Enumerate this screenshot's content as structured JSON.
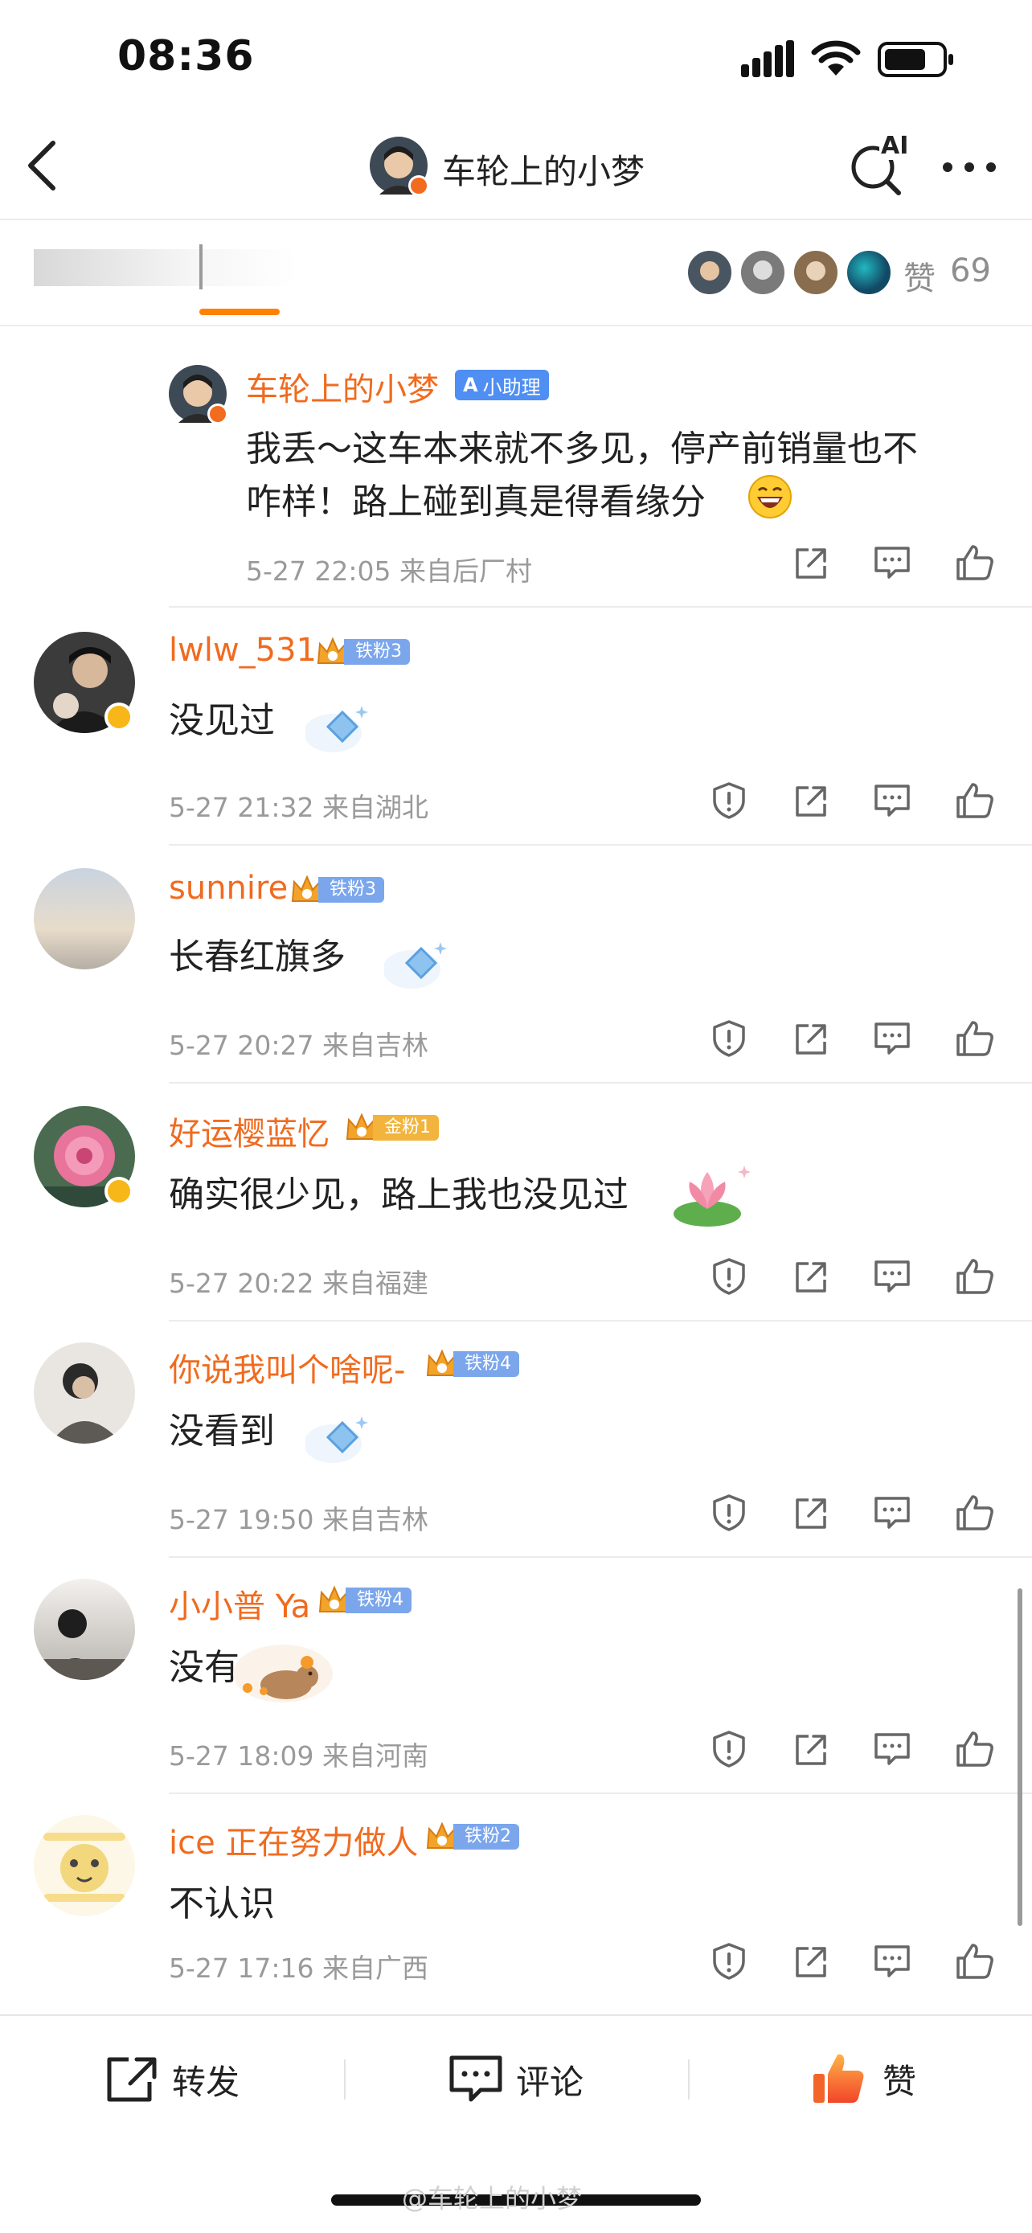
{
  "status_bar": {
    "time": "08:36"
  },
  "nav": {
    "title": "车轮上的小梦",
    "ai_label": "AI"
  },
  "subheader": {
    "like_label": "赞",
    "like_count": "69"
  },
  "reply": {
    "username": "车轮上的小梦",
    "tag": "小助理",
    "text_line1": "我丢～这车本来就不多见，停产前销量也不",
    "text_line2": "咋样！路上碰到真是得看缘分",
    "meta": "5-27 22:05  来自后厂村"
  },
  "comments": [
    {
      "username": "lwlw_531",
      "badge": "铁粉3",
      "badge_type": "iron",
      "text": "没见过",
      "meta": "5-27 21:32  来自湖北"
    },
    {
      "username": "sunnire",
      "badge": "铁粉3",
      "badge_type": "iron",
      "text": "长春红旗多",
      "meta": "5-27 20:27  来自吉林"
    },
    {
      "username": "好运樱蓝忆",
      "badge": "金粉1",
      "badge_type": "gold",
      "text": "确实很少见，路上我也没见过",
      "meta": "5-27 20:22  来自福建"
    },
    {
      "username": "你说我叫个啥呢-",
      "badge": "铁粉4",
      "badge_type": "iron",
      "text": "没看到",
      "meta": "5-27 19:50  来自吉林"
    },
    {
      "username": "小小普 Ya",
      "badge": "铁粉4",
      "badge_type": "iron",
      "text": "没有",
      "meta": "5-27 18:09  来自河南"
    },
    {
      "username": "ice 正在努力做人",
      "badge": "铁粉2",
      "badge_type": "iron",
      "text": "不认识",
      "meta": "5-27 17:16  来自广西"
    }
  ],
  "bottom_bar": {
    "repost": "转发",
    "comment": "评论",
    "like": "赞"
  },
  "watermark": "@车轮上的小梦",
  "colors": {
    "username": "#f06b1f",
    "accent": "#ff8200",
    "like_active": "#f2642a"
  }
}
